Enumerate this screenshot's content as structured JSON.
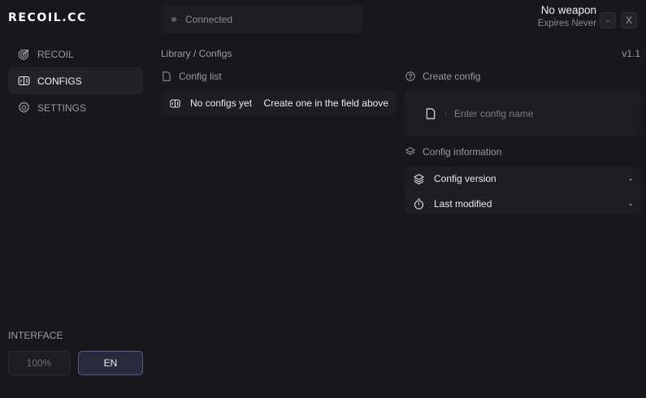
{
  "app": {
    "logo": "RECOIL.CC",
    "version": "v1.1"
  },
  "sidebar": {
    "items": [
      {
        "label": "RECOIL",
        "icon": "target-icon",
        "active": false
      },
      {
        "label": "CONFIGS",
        "icon": "config-icon",
        "active": true
      },
      {
        "label": "SETTINGS",
        "icon": "gear-icon",
        "active": false
      }
    ]
  },
  "status": {
    "text": "Connected"
  },
  "weapon": {
    "name": "No weapon",
    "expires": "Expires Never"
  },
  "window": {
    "minimize_label": "-",
    "close_label": "X"
  },
  "breadcrumb": "Library / Configs",
  "config_list": {
    "header": "Config list",
    "empty_title": "No configs yet",
    "empty_hint": "Create one in the field above"
  },
  "create_config": {
    "header": "Create config",
    "placeholder": "Enter config name",
    "value": ""
  },
  "config_info": {
    "header": "Config information",
    "rows": [
      {
        "label": "Config version",
        "value": "-"
      },
      {
        "label": "Last modified",
        "value": "-"
      }
    ]
  },
  "interface": {
    "label": "INTERFACE",
    "scale": "100%",
    "language": "EN"
  },
  "colors": {
    "accent": "#5a5890",
    "background": "#17181c",
    "card": "#1d1e22"
  }
}
